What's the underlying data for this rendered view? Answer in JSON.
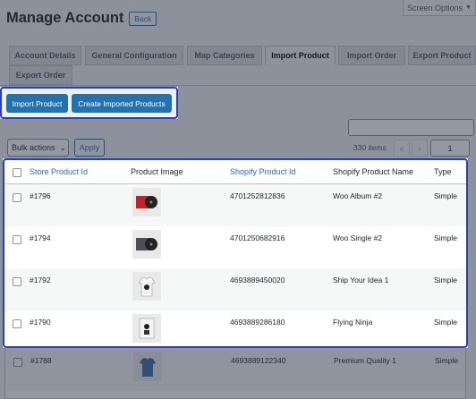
{
  "header": {
    "title": "Manage Account",
    "back_label": "Back",
    "screen_options_label": "Screen Options",
    "screen_options_arrow": "▼"
  },
  "tabs": [
    {
      "label": "Account Details"
    },
    {
      "label": "General Configuration"
    },
    {
      "label": "Map Categories"
    },
    {
      "label": "Import Product"
    },
    {
      "label": "Import Order"
    },
    {
      "label": "Export Product"
    },
    {
      "label": "Export Order"
    }
  ],
  "actions": {
    "import_product_label": "Import Product",
    "create_imported_label": "Create Imported Products"
  },
  "toolbar": {
    "bulk_actions_label": "Bulk actions",
    "bulk_arrow": "⌄",
    "apply_label": "Apply",
    "items_count": "330 items",
    "first_page": "«",
    "prev_page": "‹",
    "current_page": "1"
  },
  "table": {
    "columns": {
      "store_id": "Store Product Id",
      "image": "Product Image",
      "shopify_id": "Shopify Product Id",
      "name": "Shopify Product Name",
      "type": "Type"
    },
    "rows": [
      {
        "store_id": "#1796",
        "shopify_id": "4701252812836",
        "name": "Woo Album #2",
        "type": "Simple",
        "thumb": "album-red"
      },
      {
        "store_id": "#1794",
        "shopify_id": "4701250682916",
        "name": "Woo Single #2",
        "type": "Simple",
        "thumb": "single-dark"
      },
      {
        "store_id": "#1792",
        "shopify_id": "4693889450020",
        "name": "Ship Your Idea 1",
        "type": "Simple",
        "thumb": "tshirt-ninja"
      },
      {
        "store_id": "#1790",
        "shopify_id": "4693889286180",
        "name": "Flying Ninja",
        "type": "Simple",
        "thumb": "poster-ninja"
      },
      {
        "store_id": "#1788",
        "shopify_id": "4693889122340",
        "name": "Premium Quality 1",
        "type": "Simple",
        "thumb": "tshirt-blue"
      }
    ]
  },
  "colors": {
    "accent": "#2271b1",
    "highlight": "#1e3ed6",
    "overlay": "#283246"
  }
}
